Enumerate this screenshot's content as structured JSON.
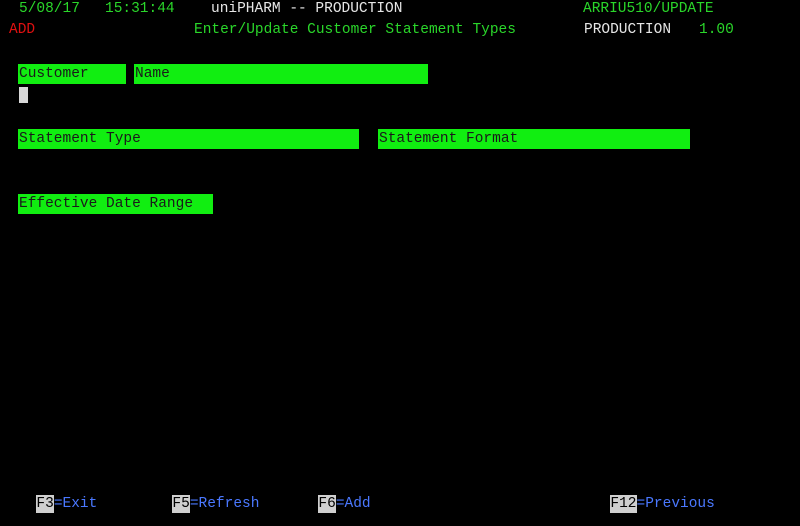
{
  "header": {
    "date": "5/08/17",
    "time": "15:31:44",
    "system_title": "uniPHARM -- PRODUCTION",
    "program_id": "ARRIU510/UPDATE",
    "mode": "ADD",
    "screen_title": "Enter/Update Customer Statement Types",
    "environment": "PRODUCTION",
    "version": "1.00"
  },
  "fields": {
    "customer_label": "Customer",
    "name_label": "Name",
    "statement_type_label": "Statement Type",
    "statement_format_label": "Statement Format",
    "effective_date_range_label": "Effective Date Range"
  },
  "function_keys": [
    {
      "key": "F3",
      "label": "=Exit"
    },
    {
      "key": "F5",
      "label": "=Refresh"
    },
    {
      "key": "F6",
      "label": "=Add"
    },
    {
      "key": "F12",
      "label": "=Previous"
    }
  ],
  "colors": {
    "background": "#000000",
    "field_label_bg": "#11ee11",
    "header_green": "#2ad62a",
    "mode_red": "#e01010",
    "fkey_blue": "#4a78ff"
  }
}
